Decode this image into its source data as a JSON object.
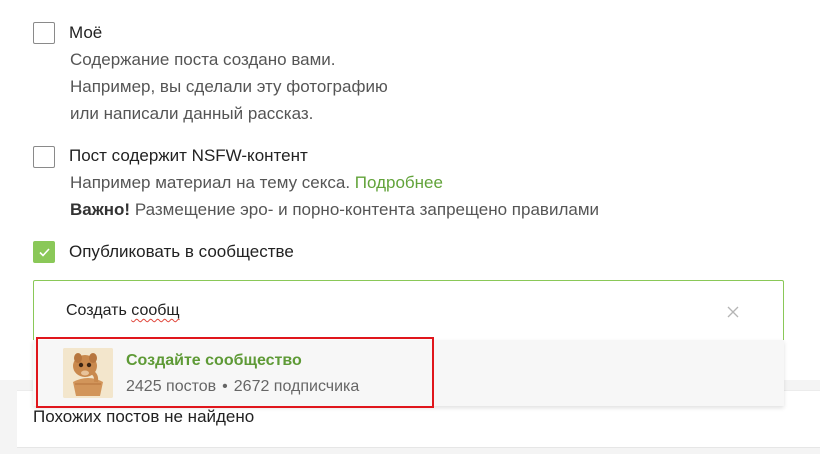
{
  "options": {
    "mine": {
      "label": "Моё",
      "lines": [
        "Содержание поста создано вами.",
        "Например, вы сделали эту фотографию",
        "или написали данный рассказ."
      ],
      "checked": false
    },
    "nsfw": {
      "label": "Пост содержит NSFW-контент",
      "line1": "Например материал на тему секса.",
      "link": "Подробнее",
      "important": "Важно!",
      "line2": "Размещение эро- и порно-контента запрещено правилами",
      "checked": false
    },
    "community": {
      "label": "Опубликовать в сообществе",
      "checked": true
    }
  },
  "search": {
    "prefix": "Создать",
    "word": "сообщ"
  },
  "suggestion": {
    "name": "Создайте сообщество",
    "posts": "2425 постов",
    "separator": "•",
    "subscribers": "2672 подписчика",
    "avatar_icon": "mascot-avatar-icon"
  },
  "similar": {
    "message": "Похожих постов не найдено"
  },
  "colors": {
    "accent": "#8ac858",
    "link": "#62a33a",
    "highlight": "#e0161c"
  }
}
